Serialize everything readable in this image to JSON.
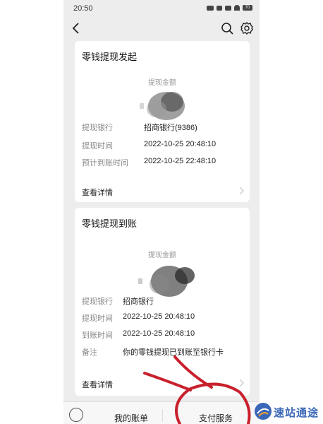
{
  "status_bar": {
    "time": "20:50",
    "battery": "70"
  },
  "cards": [
    {
      "title": "零钱提现发起",
      "amount_label": "提现金额",
      "rows": [
        {
          "label": "提现银行",
          "value": "招商银行(9386)"
        },
        {
          "label": "提现时间",
          "value": "2022-10-25 20:48:10"
        },
        {
          "label": "预计到账时间",
          "value": "2022-10-25 22:48:10"
        }
      ],
      "detail_link": "查看详情"
    },
    {
      "title": "零钱提现到账",
      "amount_label": "提现金额",
      "rows": [
        {
          "label": "提现银行",
          "value": "招商银行"
        },
        {
          "label": "提现时间",
          "value": "2022-10-25 20:48:10"
        },
        {
          "label": "到账时间",
          "value": "2022-10-25 20:48:10"
        },
        {
          "label": "备注",
          "value": "你的零钱提现已到账至银行卡"
        }
      ],
      "detail_link": "查看详情"
    }
  ],
  "bottom_menu": {
    "bills": "我的账单",
    "pay_services": "支付服务"
  },
  "watermark": {
    "text": "速站通途"
  },
  "colors": {
    "annotation_red": "#c8202c",
    "watermark_blue": "#3a67b8",
    "background": "#ededed"
  }
}
